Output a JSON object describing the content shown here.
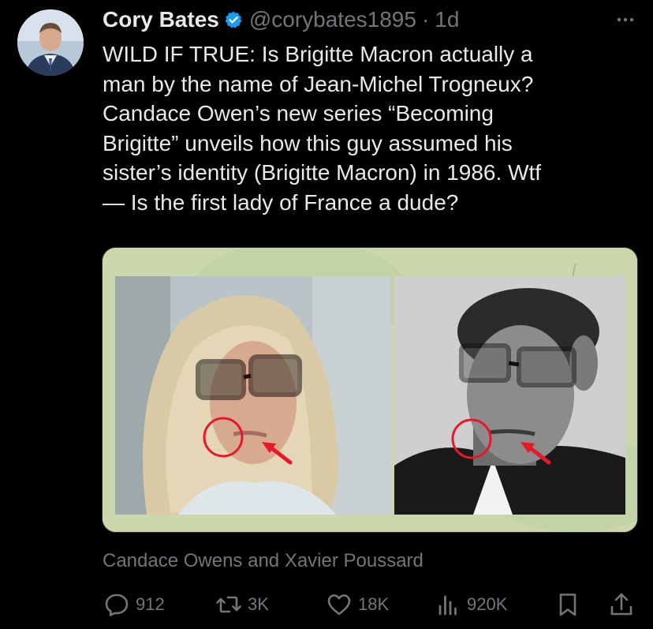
{
  "author": {
    "name": "Cory Bates",
    "handle": "@corybates1895",
    "separator": "·",
    "time": "1d"
  },
  "tweet": {
    "text": "WILD IF TRUE:  Is Brigitte Macron actually a\nman by the name of Jean-Michel Trogneux?\nCandace Owen’s new series “Becoming\nBrigitte” unveils how this guy assumed his\nsister’s identity (Brigitte Macron) in 1986.  Wtf\n— Is the first lady of France a dude?"
  },
  "media": {
    "caption": "Candace Owens and Xavier Poussard",
    "frame_color": "#cbd8ae",
    "highlight_color": "#e8182a"
  },
  "actions": {
    "replies": "912",
    "reposts": "3K",
    "likes": "18K",
    "views": "920K"
  },
  "icons": {
    "verified": "verified-badge-icon",
    "more": "more-icon",
    "reply": "reply-icon",
    "repost": "repost-icon",
    "like": "heart-icon",
    "views": "views-icon",
    "bookmark": "bookmark-icon",
    "share": "share-icon"
  },
  "colors": {
    "background": "#000000",
    "text": "#e7e9ea",
    "secondary": "#71767b",
    "verified": "#1d9bf0"
  }
}
